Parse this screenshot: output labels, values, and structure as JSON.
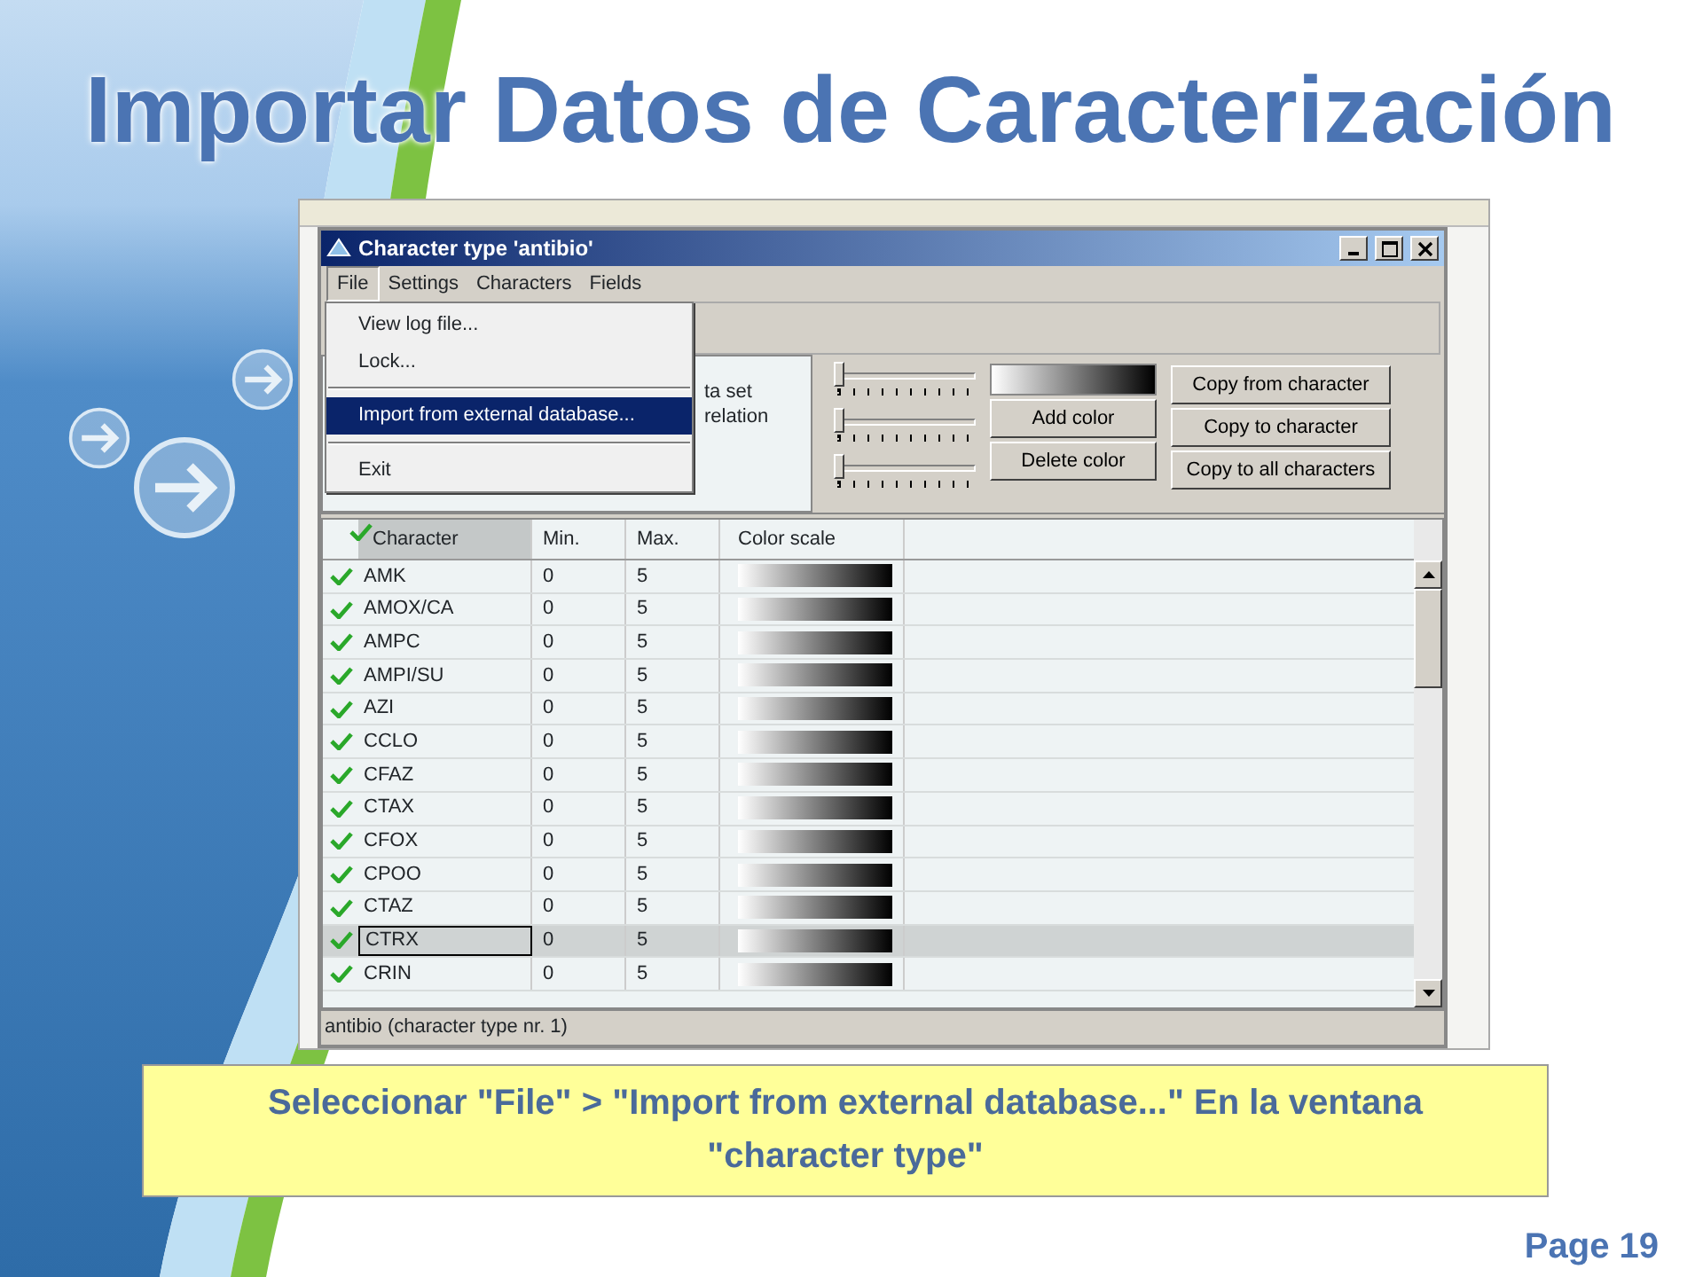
{
  "slide": {
    "title": "Importar Datos de Caracterización",
    "caption": "Seleccionar \"File\" > \"Import from external database...\" En la ventana \"character type\"",
    "page": "Page 19"
  },
  "window": {
    "title": "Character type 'antibio'",
    "menu": [
      {
        "label": "File",
        "selected": true
      },
      {
        "label": "Settings",
        "selected": false
      },
      {
        "label": "Characters",
        "selected": false
      },
      {
        "label": "Fields",
        "selected": false
      }
    ],
    "file_menu": [
      {
        "kind": "item",
        "label": "View log file...",
        "selected": false
      },
      {
        "kind": "item",
        "label": "Lock...",
        "selected": false
      },
      {
        "kind": "separator"
      },
      {
        "kind": "item",
        "label": "Import from external database...",
        "selected": true
      },
      {
        "kind": "separator"
      },
      {
        "kind": "item",
        "label": "Exit",
        "selected": false
      }
    ],
    "panel_texts": [
      "ta set",
      "relation"
    ],
    "sliders": [
      {
        "level": 0
      },
      {
        "level": 0
      },
      {
        "level": 0
      }
    ],
    "color_buttons": [
      "Add color",
      "Delete color"
    ],
    "copy_buttons": [
      "Copy from character",
      "Copy to character",
      "Copy to all characters"
    ],
    "table": {
      "columns": [
        "Character",
        "Min.",
        "Max.",
        "Color scale"
      ],
      "rows": [
        {
          "character": "AMK",
          "min": "0",
          "max": "5",
          "checked": true,
          "selected": false
        },
        {
          "character": "AMOX/CA",
          "min": "0",
          "max": "5",
          "checked": true,
          "selected": false
        },
        {
          "character": "AMPC",
          "min": "0",
          "max": "5",
          "checked": true,
          "selected": false
        },
        {
          "character": "AMPI/SU",
          "min": "0",
          "max": "5",
          "checked": true,
          "selected": false
        },
        {
          "character": "AZI",
          "min": "0",
          "max": "5",
          "checked": true,
          "selected": false
        },
        {
          "character": "CCLO",
          "min": "0",
          "max": "5",
          "checked": true,
          "selected": false
        },
        {
          "character": "CFAZ",
          "min": "0",
          "max": "5",
          "checked": true,
          "selected": false
        },
        {
          "character": "CTAX",
          "min": "0",
          "max": "5",
          "checked": true,
          "selected": false
        },
        {
          "character": "CFOX",
          "min": "0",
          "max": "5",
          "checked": true,
          "selected": false
        },
        {
          "character": "CPOO",
          "min": "0",
          "max": "5",
          "checked": true,
          "selected": false
        },
        {
          "character": "CTAZ",
          "min": "0",
          "max": "5",
          "checked": true,
          "selected": false
        },
        {
          "character": "CTRX",
          "min": "0",
          "max": "5",
          "checked": true,
          "selected": true
        },
        {
          "character": "CRIN",
          "min": "0",
          "max": "5",
          "checked": true,
          "selected": false
        }
      ]
    },
    "status_bar": "antibio (character type nr. 1)"
  }
}
